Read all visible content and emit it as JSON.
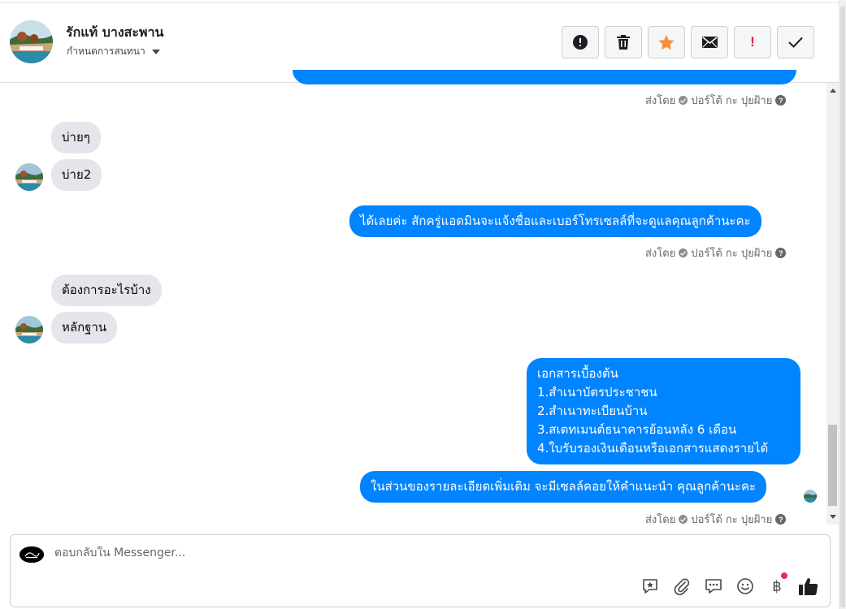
{
  "header": {
    "page_name": "รักแท้ บางสะพาน",
    "conversation_settings": "กำหนดการสนทนา",
    "toolbar": [
      {
        "name": "info-icon"
      },
      {
        "name": "trash-icon"
      },
      {
        "name": "star-icon"
      },
      {
        "name": "envelope-icon"
      },
      {
        "name": "spam-icon",
        "label": "!"
      },
      {
        "name": "checkmark-icon"
      }
    ]
  },
  "messages": [
    {
      "direction": "in",
      "text": "บ่ายๆ"
    },
    {
      "direction": "in",
      "text": "บ่าย2"
    },
    {
      "direction": "out",
      "text": "ได้เลยค่ะ สักครู่แอดมินจะแจ้งชื่อและเบอร์โทรเซลล์ที่จะดูแลคุณลูกค้านะคะ"
    },
    {
      "direction": "in",
      "text": "ต้องการอะไรบ้าง"
    },
    {
      "direction": "in",
      "text": "หลักฐาน"
    },
    {
      "direction": "out",
      "lines": [
        "เอกสารเบื้องต้น",
        "1.สำเนาบัตรประชาชน",
        "2.สำเนาทะเบียนบ้าน",
        "3.สเตทเมนต์ธนาคารย้อนหลัง 6 เดือน",
        "4.ใบรับรองเงินเดือนหรือเอกสารแสดงรายได้"
      ]
    },
    {
      "direction": "out",
      "text": "ในส่วนของรายละเอียดเพิ่มเติม จะมีเซลล์คอยให้คำแนะนำ คุณลูกค้านะคะ"
    }
  ],
  "sent_by": {
    "prefix": "ส่งโดย",
    "sender": "ปอร์โต้ กะ ปุยฝ้าย"
  },
  "composer": {
    "placeholder": "ตอบกลับใน Messenger...",
    "icons": [
      "saved-reply-icon",
      "paperclip-icon",
      "chat-bubbles-icon",
      "emoji-icon",
      "baht-payment-icon",
      "thumbs-up-icon"
    ],
    "baht_symbol": "฿"
  },
  "colors": {
    "outgoing": "#0084ff",
    "incoming": "#e4e6eb",
    "accent_star": "#f7923b",
    "spam": "#e41e3f"
  }
}
